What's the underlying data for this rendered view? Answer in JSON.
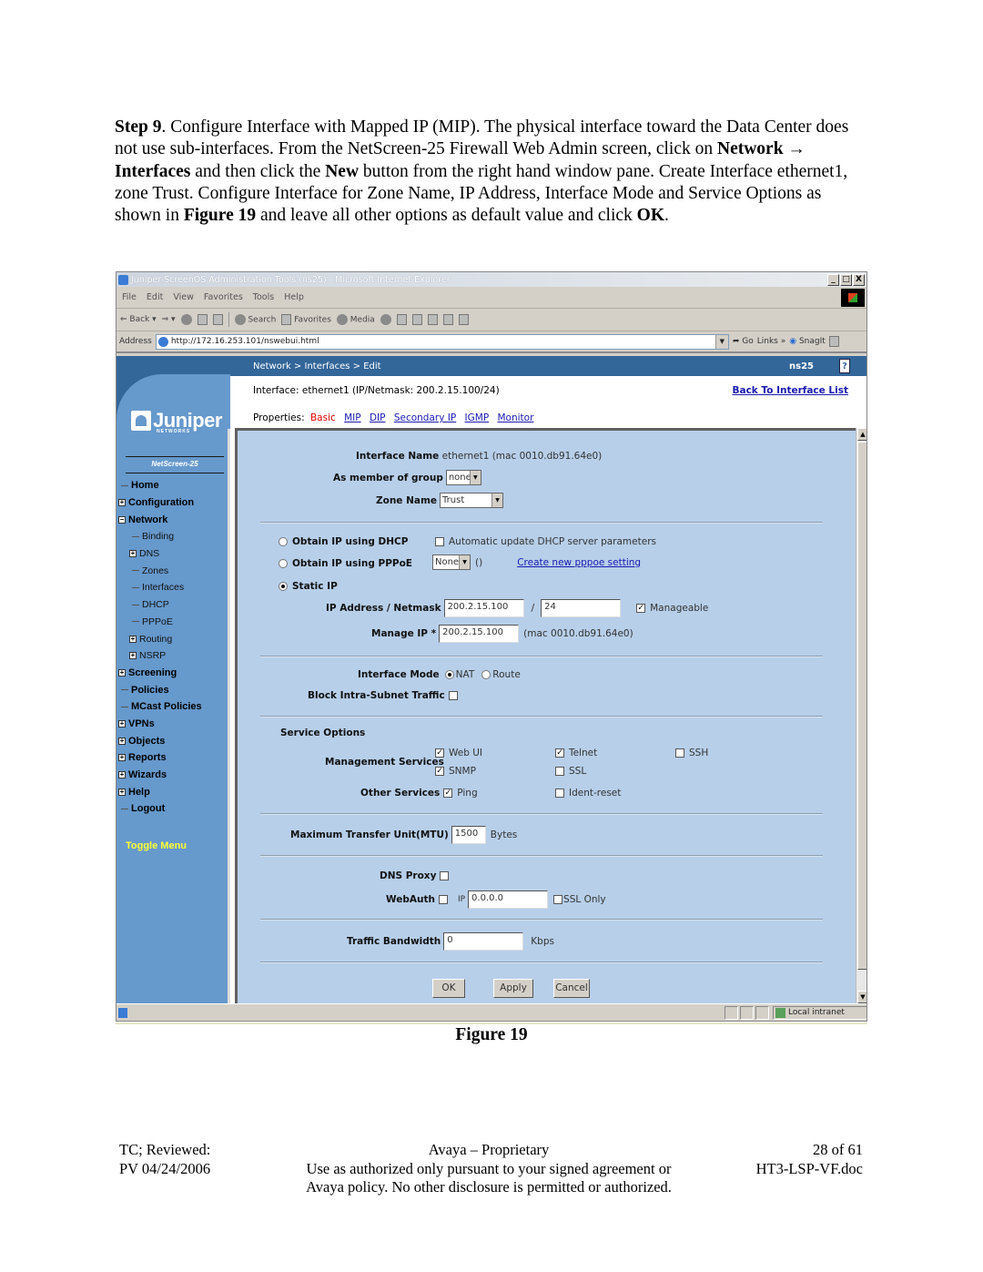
{
  "intro": {
    "step_label": "Step 9",
    "t1": ". Configure Interface with Mapped IP (MIP). The physical interface toward the Data Center does not use sub-interfaces. From the NetScreen-25 Firewall Web Admin screen, click on ",
    "nav_path": "Network → Interfaces",
    "t2": " and then click the ",
    "new_label": "New",
    "t3": " button from the right hand window pane. Create Interface ethernet1, zone Trust. Configure Interface for Zone Name, IP Address, Interface Mode and Service Options as shown in ",
    "figure_ref": "Figure 19",
    "t4": " and leave all other options as default value and click ",
    "ok_label": "OK",
    "t5": "."
  },
  "browser": {
    "title": "Juniper-ScreenOS Administration Tools (ns25) - Microsoft Internet Explorer",
    "window_buttons": [
      "_",
      "□",
      "X"
    ],
    "menu": [
      "File",
      "Edit",
      "View",
      "Favorites",
      "Tools",
      "Help"
    ],
    "toolbar": {
      "back": "Back",
      "search": "Search",
      "favorites": "Favorites",
      "media": "Media"
    },
    "address_label": "Address",
    "url": "http://172.16.253.101/nswebui.html",
    "go": "Go",
    "links": "Links »",
    "snagit": "SnagIt",
    "status_zone": "Local intranet"
  },
  "app": {
    "breadcrumb": "Network > Interfaces > Edit",
    "host": "ns25",
    "help": "?",
    "interface_header": "Interface: ethernet1 (IP/Netmask: 200.2.15.100/24)",
    "back_link": "Back To Interface List",
    "properties_label": "Properties:",
    "properties": [
      {
        "label": "Basic",
        "active": true
      },
      {
        "label": "MIP",
        "active": false
      },
      {
        "label": "DIP",
        "active": false
      },
      {
        "label": "Secondary IP",
        "active": false
      },
      {
        "label": "IGMP",
        "active": false
      },
      {
        "label": "Monitor",
        "active": false
      }
    ]
  },
  "sidebar": {
    "logo": "Juniper",
    "logo_sub": "NETWORKS",
    "product": "NetScreen-25",
    "items": [
      {
        "label": "Home",
        "level": 0,
        "marker": "dash"
      },
      {
        "label": "Configuration",
        "level": 0,
        "marker": "plus"
      },
      {
        "label": "Network",
        "level": 0,
        "marker": "minus"
      },
      {
        "label": "Binding",
        "level": 1,
        "marker": "dash"
      },
      {
        "label": "DNS",
        "level": 1,
        "marker": "plus"
      },
      {
        "label": "Zones",
        "level": 1,
        "marker": "dash"
      },
      {
        "label": "Interfaces",
        "level": 1,
        "marker": "dash"
      },
      {
        "label": "DHCP",
        "level": 1,
        "marker": "dash"
      },
      {
        "label": "PPPoE",
        "level": 1,
        "marker": "dash"
      },
      {
        "label": "Routing",
        "level": 1,
        "marker": "plus"
      },
      {
        "label": "NSRP",
        "level": 1,
        "marker": "plus"
      },
      {
        "label": "Screening",
        "level": 0,
        "marker": "plus"
      },
      {
        "label": "Policies",
        "level": 0,
        "marker": "dash"
      },
      {
        "label": "MCast Policies",
        "level": 0,
        "marker": "dash"
      },
      {
        "label": "VPNs",
        "level": 0,
        "marker": "plus"
      },
      {
        "label": "Objects",
        "level": 0,
        "marker": "plus"
      },
      {
        "label": "Reports",
        "level": 0,
        "marker": "plus"
      },
      {
        "label": "Wizards",
        "level": 0,
        "marker": "plus"
      },
      {
        "label": "Help",
        "level": 0,
        "marker": "plus"
      },
      {
        "label": "Logout",
        "level": 0,
        "marker": "dash"
      }
    ],
    "toggle_menu": "Toggle Menu"
  },
  "form": {
    "interface_name_label": "Interface Name",
    "interface_name_value": "ethernet1 (mac 0010.db91.64e0)",
    "group_label": "As member of group",
    "group_value": "none",
    "zone_label": "Zone Name",
    "zone_value": "Trust",
    "dhcp_label": "Obtain IP using DHCP",
    "dhcp_selected": false,
    "dhcp_auto_label": "Automatic update DHCP server parameters",
    "dhcp_auto_checked": false,
    "pppoe_label": "Obtain IP using PPPoE",
    "pppoe_selected": false,
    "pppoe_value": "None",
    "pppoe_paren": "()",
    "pppoe_link": "Create new pppoe setting",
    "static_label": "Static IP",
    "static_selected": true,
    "ip_label": "IP Address / Netmask",
    "ip_value": "200.2.15.100",
    "slash": "/",
    "netmask_value": "24",
    "manageable_label": "Manageable",
    "manageable_checked": true,
    "manage_ip_label": "Manage IP *",
    "manage_ip_value": "200.2.15.100",
    "manage_ip_mac": "(mac 0010.db91.64e0)",
    "mode_label": "Interface Mode",
    "mode_nat": "NAT",
    "mode_route": "Route",
    "mode_selected": "NAT",
    "block_label": "Block Intra-Subnet Traffic",
    "block_checked": false,
    "service_options_title": "Service Options",
    "mgmt_label": "Management Services",
    "mgmt_services": [
      {
        "label": "Web UI",
        "checked": true
      },
      {
        "label": "Telnet",
        "checked": true
      },
      {
        "label": "SSH",
        "checked": false
      },
      {
        "label": "SNMP",
        "checked": true
      },
      {
        "label": "SSL",
        "checked": false
      }
    ],
    "other_label": "Other Services",
    "other_services": [
      {
        "label": "Ping",
        "checked": true
      },
      {
        "label": "Ident-reset",
        "checked": false
      }
    ],
    "mtu_label": "Maximum Transfer Unit(MTU)",
    "mtu_value": "1500",
    "mtu_unit": "Bytes",
    "dns_proxy_label": "DNS Proxy",
    "dns_proxy_checked": false,
    "webauth_label": "WebAuth",
    "webauth_checked": false,
    "webauth_ip_label": "IP",
    "webauth_ip_value": "0.0.0.0",
    "ssl_only_label": "SSL Only",
    "ssl_only_checked": false,
    "bandwidth_label": "Traffic Bandwidth",
    "bandwidth_value": "0",
    "bandwidth_unit": "Kbps",
    "buttons": {
      "ok": "OK",
      "apply": "Apply",
      "cancel": "Cancel"
    }
  },
  "caption": "Figure 19",
  "footer": {
    "left": [
      "TC; Reviewed:",
      "PV 04/24/2006"
    ],
    "center": [
      "Avaya – Proprietary",
      "Use as authorized only pursuant to your signed agreement or",
      "Avaya policy. No other disclosure is permitted or authorized."
    ],
    "right": [
      "28 of 61",
      "HT3-LSP-VF.doc"
    ]
  },
  "colors": {
    "nav_blue": "#6699cc",
    "top_bar": "#336699",
    "form_bg": "#b7cfe9",
    "link": "#1a1ab0",
    "active_tab": "#e00000",
    "toggle_menu": "#ffff33"
  }
}
